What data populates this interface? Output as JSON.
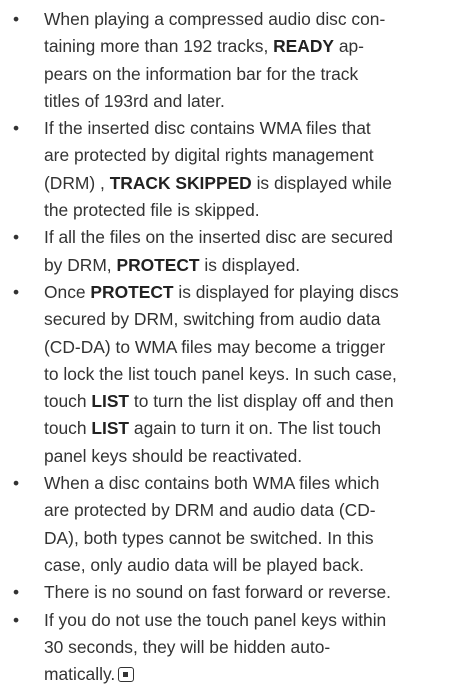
{
  "bullets": [
    {
      "parts": [
        "When playing a compressed audio disc con-",
        "taining more than 192 tracks, ",
        "READY",
        " ap-",
        "pears on the information bar for the track",
        "titles of 193rd and later."
      ]
    },
    {
      "parts": [
        "If the inserted disc contains WMA files that",
        "are protected by digital rights management",
        "(DRM) , ",
        "TRACK SKIPPED",
        " is displayed while",
        "the protected file is skipped."
      ]
    },
    {
      "parts": [
        "If all the files on the inserted disc are secured",
        "by DRM, ",
        "PROTECT",
        " is displayed."
      ]
    },
    {
      "parts": [
        "Once ",
        "PROTECT",
        " is displayed for playing discs",
        "secured by DRM, switching from audio data",
        "(CD-DA) to WMA files may become a trigger",
        "to lock the list touch panel keys. In such case,",
        "touch ",
        "LIST",
        " to turn the list display off and then",
        "touch ",
        "LIST",
        " again to turn it on. The list touch",
        "panel keys should be reactivated."
      ]
    },
    {
      "parts": [
        "When a disc contains both WMA files which",
        "are protected by DRM and audio data (CD-",
        "DA), both types cannot be switched. In this",
        "case, only audio data will be played back."
      ]
    },
    {
      "parts": [
        "There is no sound on fast forward or reverse."
      ]
    },
    {
      "parts": [
        "If you do not use the touch panel keys within",
        "30 seconds, they will be hidden auto-",
        "matically."
      ]
    }
  ],
  "end_mark_icon": "end-of-section-icon"
}
